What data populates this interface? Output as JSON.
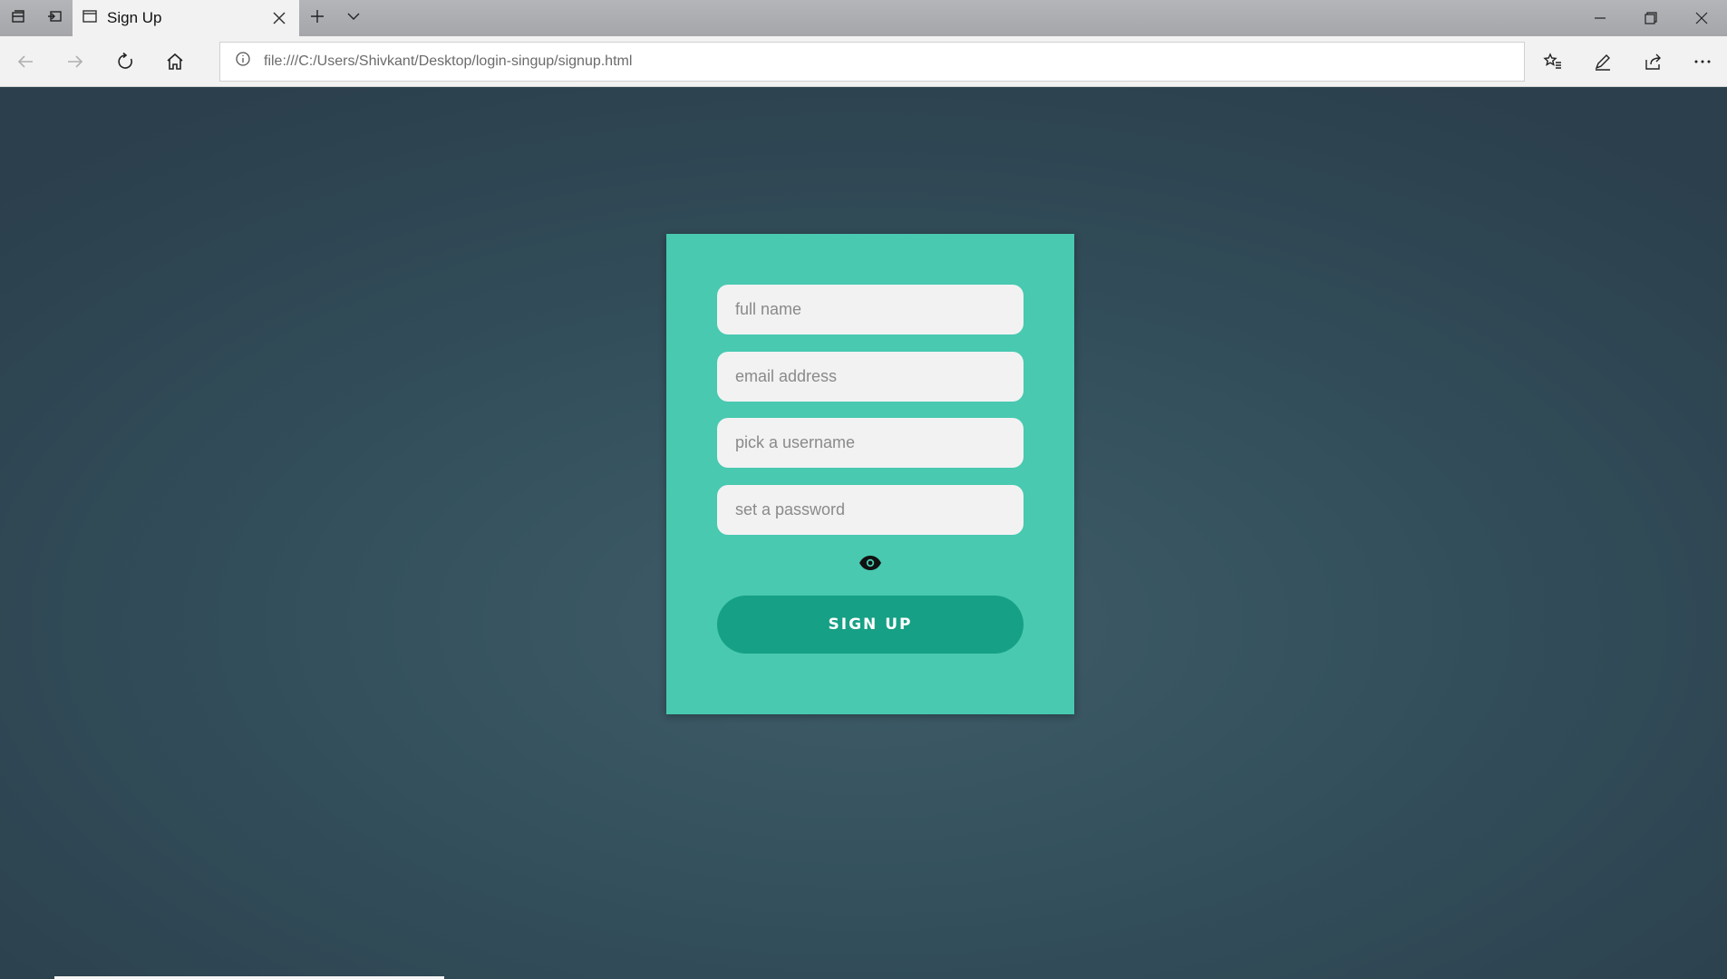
{
  "tab": {
    "title": "Sign Up"
  },
  "address": {
    "url": "file:///C:/Users/Shivkant/Desktop/login-singup/signup.html"
  },
  "form": {
    "full_name_placeholder": "full name",
    "email_placeholder": "email address",
    "username_placeholder": "pick a username",
    "password_placeholder": "set a password",
    "submit_label": "SIGN UP"
  },
  "icons": {
    "tab_actions": [
      "tabs-aside-icon",
      "restore-tabs-icon"
    ],
    "tab": [
      "page-icon",
      "close-icon"
    ],
    "tab_tools": [
      "plus-icon",
      "chevron-down-icon"
    ],
    "window": [
      "minimize-icon",
      "restore-icon",
      "close-icon"
    ],
    "nav": [
      "back-icon",
      "forward-icon",
      "refresh-icon",
      "home-icon"
    ],
    "tools": [
      "favorites-icon",
      "pen-icon",
      "share-icon",
      "more-icon"
    ],
    "form": [
      "eye-icon"
    ]
  },
  "colors": {
    "background": "#2f4452",
    "card": "#48c9b0",
    "input": "#f2f2f2",
    "button": "#16a085"
  }
}
